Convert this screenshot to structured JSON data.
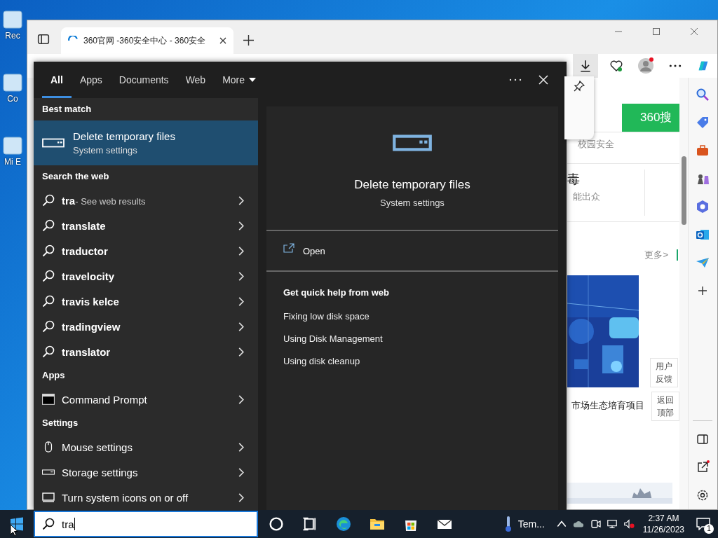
{
  "desktop": {
    "icons": [
      {
        "label": "Rec"
      },
      {
        "label": "Co"
      },
      {
        "label": "Mi E"
      }
    ]
  },
  "browser": {
    "tab": {
      "title": "360官网 -360安全中心 - 360安全"
    },
    "page": {
      "search_button": "360搜",
      "nav_link": "校园安全",
      "card_title": "毒",
      "card_subtitle": "能出众",
      "more_link": "更多>",
      "news_title": "市场生态培育项目",
      "feedback": "用户反馈",
      "back_to_top": "返回顶部"
    }
  },
  "search": {
    "tabs": [
      {
        "label": "All",
        "selected": true,
        "dropdown": false
      },
      {
        "label": "Apps",
        "selected": false,
        "dropdown": false
      },
      {
        "label": "Documents",
        "selected": false,
        "dropdown": false
      },
      {
        "label": "Web",
        "selected": false,
        "dropdown": false
      },
      {
        "label": "More",
        "selected": false,
        "dropdown": true
      }
    ],
    "sections": [
      {
        "title": "Best match",
        "items": [
          {
            "kind": "best",
            "title": "Delete temporary files",
            "subtitle": "System settings",
            "selected": true
          }
        ]
      },
      {
        "title": "Search the web",
        "items": [
          {
            "kind": "web",
            "title": "tra",
            "hint": "- See web results",
            "selected": false
          },
          {
            "kind": "web",
            "title": "translate",
            "selected": false
          },
          {
            "kind": "web",
            "title": "traductor",
            "selected": false
          },
          {
            "kind": "web",
            "title": "travelocity",
            "selected": false
          },
          {
            "kind": "web",
            "title": "travis kelce",
            "selected": false
          },
          {
            "kind": "web",
            "title": "tradingview",
            "selected": false
          },
          {
            "kind": "web",
            "title": "translator",
            "selected": false
          }
        ]
      },
      {
        "title": "Apps",
        "items": [
          {
            "kind": "app",
            "title": "Command Prompt",
            "selected": false
          }
        ]
      },
      {
        "title": "Settings",
        "items": [
          {
            "kind": "setting",
            "title": "Mouse settings",
            "selected": false
          },
          {
            "kind": "setting",
            "title": "Storage settings",
            "selected": false
          },
          {
            "kind": "setting",
            "title": "Turn system icons on or off",
            "selected": false
          }
        ]
      }
    ],
    "preview": {
      "title": "Delete temporary files",
      "subtitle": "System settings",
      "actions": [
        {
          "label": "Open"
        }
      ],
      "help_title": "Get quick help from web",
      "help_links": [
        "Fixing low disk space",
        "Using Disk Management",
        "Using disk cleanup"
      ]
    }
  },
  "taskbar": {
    "search": {
      "value": "tra"
    },
    "weather": "Tem...",
    "time": "2:37 AM",
    "date": "11/26/2023",
    "notifications": "1"
  }
}
